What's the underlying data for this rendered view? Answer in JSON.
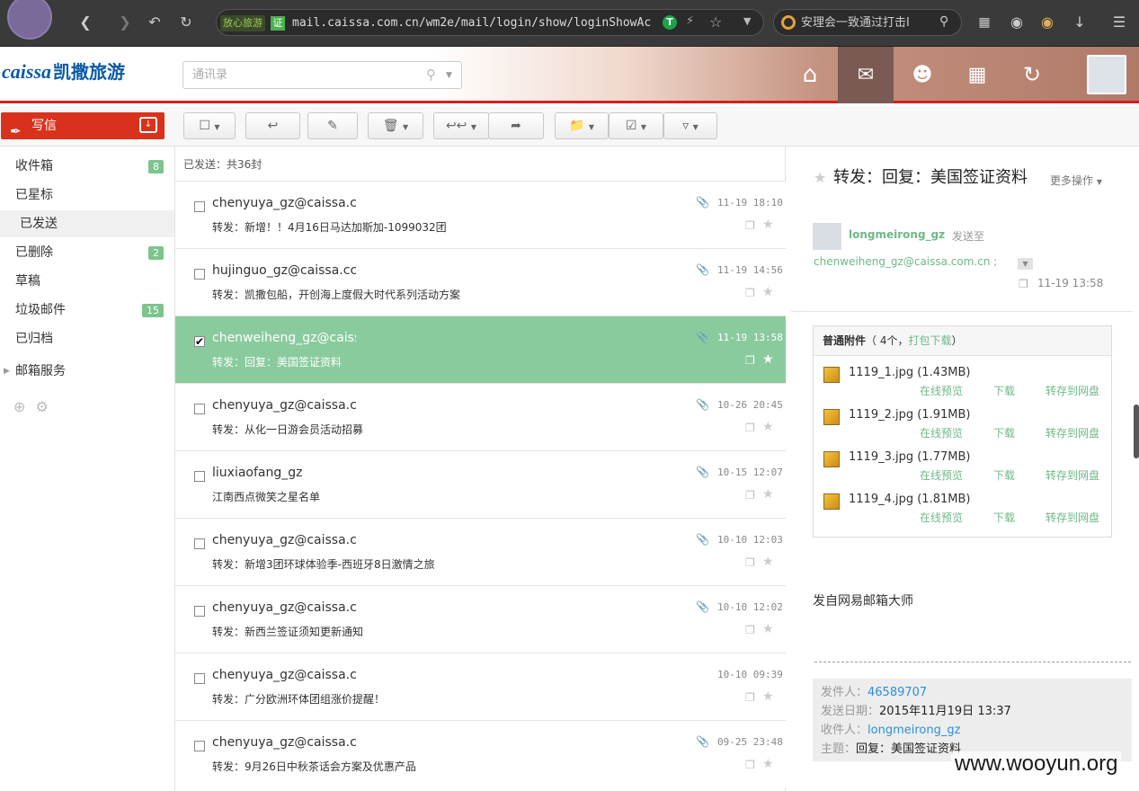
{
  "browser": {
    "url_tag": "放心旅游",
    "url_cert": "证",
    "url": "mail.caissa.com.cn/wm2e/mail/login/show/loginShowAc",
    "search_text": "安理会一致通过打击I"
  },
  "app": {
    "logo_en": "caissa",
    "logo_cn": "凯撒旅游",
    "contacts_placeholder": "通讯录"
  },
  "sidebar": {
    "compose_label": "写信",
    "items": [
      {
        "label": "收件箱",
        "count": "8"
      },
      {
        "label": "已星标",
        "count": ""
      },
      {
        "label": "已发送",
        "count": ""
      },
      {
        "label": "已删除",
        "count": "2"
      },
      {
        "label": "草稿",
        "count": ""
      },
      {
        "label": "垃圾邮件",
        "count": "15"
      },
      {
        "label": "已归档",
        "count": ""
      }
    ],
    "service_label": "邮箱服务"
  },
  "list": {
    "summary": "已发送：共36封",
    "rows": [
      {
        "sender": "chenyuya_gz@caissa.c",
        "subject": "转发：新增！！4月16日马达加斯加-1099032团",
        "time": "11-19 18:10",
        "checked": "",
        "attach": true
      },
      {
        "sender": "hujinguo_gz@caissa.cc",
        "subject": "转发：凯撒包船，开创海上度假大时代系列活动方案",
        "time": "11-19 14:56",
        "checked": "",
        "attach": true
      },
      {
        "sender": "chenweiheng_gz@caiss",
        "subject": "转发：回复：美国签证资料",
        "time": "11-19 13:58",
        "checked": "✔",
        "attach": true
      },
      {
        "sender": "chenyuya_gz@caissa.c",
        "subject": "转发：从化一日游会员活动招募",
        "time": "10-26 20:45",
        "checked": "",
        "attach": true
      },
      {
        "sender": "liuxiaofang_gz",
        "subject": "江南西点微笑之星名单",
        "time": "10-15 12:07",
        "checked": "",
        "attach": true
      },
      {
        "sender": "chenyuya_gz@caissa.c",
        "subject": "转发：新增3团环球体验季-西班牙8日激情之旅",
        "time": "10-10 12:03",
        "checked": "",
        "attach": true
      },
      {
        "sender": "chenyuya_gz@caissa.c",
        "subject": "转发：新西兰签证须知更新通知",
        "time": "10-10 12:02",
        "checked": "",
        "attach": true
      },
      {
        "sender": "chenyuya_gz@caissa.c",
        "subject": "转发：广分欧洲环体团组涨价提醒！",
        "time": "10-10 09:39",
        "checked": "",
        "attach": false
      },
      {
        "sender": "chenyuya_gz@caissa.c",
        "subject": "转发：9月26日中秋茶话会方案及优惠产品",
        "time": "09-25 23:48",
        "checked": "",
        "attach": true
      }
    ]
  },
  "reader": {
    "title": "转发：回复：美国签证资料",
    "more_actions": "更多操作",
    "from": "longmeirong_gz",
    "send_to_label": "发送至",
    "to": "chenweiheng_gz@caissa.com.cn ;",
    "date": "11-19 13:58",
    "attachments": {
      "label": "普通附件",
      "count_text": "（ 4个，",
      "download_all": "打包下载",
      "close_paren": "）",
      "preview_label": "在线预览",
      "download_label": "下载",
      "save_label": "转存到网盘",
      "files": [
        "1119_1.jpg (1.43MB)",
        "1119_2.jpg (1.91MB)",
        "1119_3.jpg (1.77MB)",
        "1119_4.jpg (1.81MB)"
      ]
    },
    "signature": "发自网易邮箱大师",
    "quote": {
      "sender_label": "发件人：",
      "sender": "46589707",
      "date_label": "发送日期：",
      "date": "2015年11月19日 13:37",
      "to_label": "收件人：",
      "to": "longmeirong_gz",
      "subject_label": "主题：",
      "subject": "回复：美国签证资料"
    }
  },
  "watermark": "www.wooyun.org",
  "colors": {
    "accent_red": "#d9321c",
    "selected_row": "#8acb9d",
    "link_green": "#6fb889"
  }
}
